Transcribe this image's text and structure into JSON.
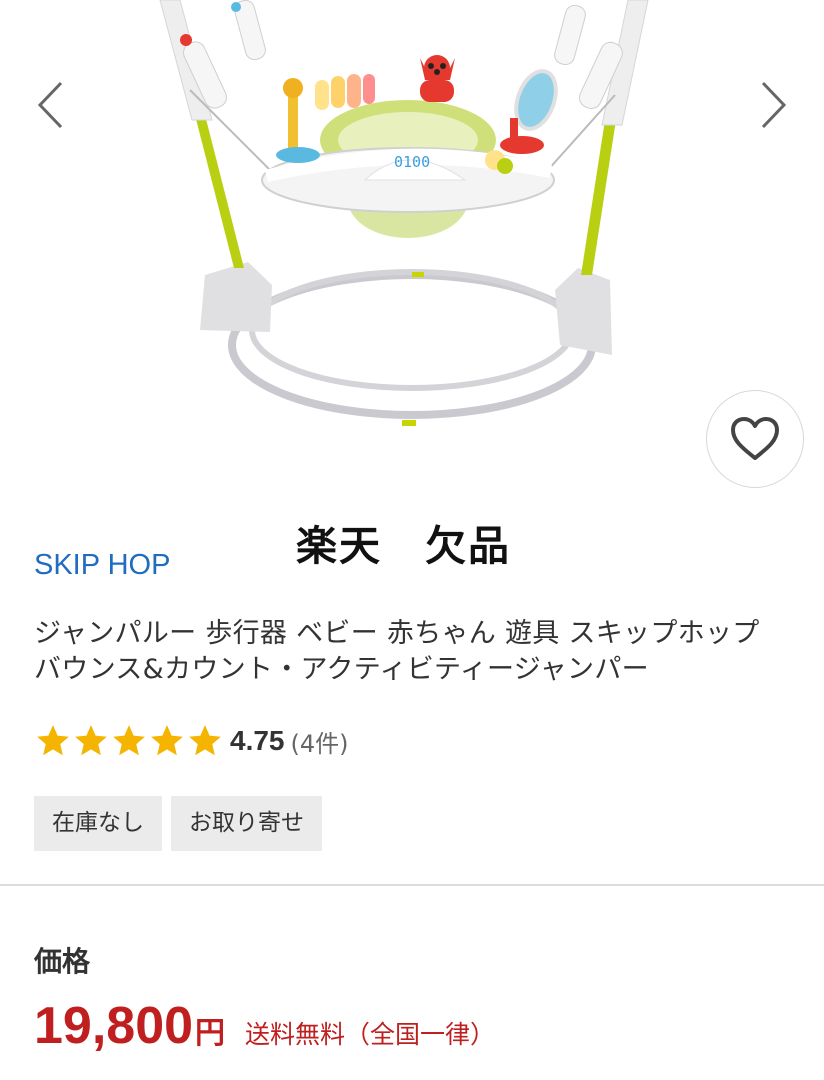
{
  "overlay_note": "楽天　欠品",
  "product": {
    "brand": "SKIP HOP",
    "title": "ジャンパルー 歩行器 ベビー 赤ちゃん 遊具 スキップホップ バウンス&カウント・アクティビティージャンパー",
    "image_display": "0100",
    "rating": {
      "value": "4.75",
      "count": "(4件)",
      "stars": 5
    },
    "tags": [
      "在庫なし",
      "お取り寄せ"
    ]
  },
  "price": {
    "label": "価格",
    "amount": "19,800",
    "unit": "円",
    "shipping": "送料無料（全国一律）"
  },
  "icons": {
    "prev": "chevron-left-icon",
    "next": "chevron-right-icon",
    "favorite": "heart-icon",
    "star": "star-icon"
  },
  "colors": {
    "brand_link": "#1f6cc0",
    "price": "#bf1f1f",
    "star": "#f5b400",
    "tag_bg": "#ebebeb"
  }
}
